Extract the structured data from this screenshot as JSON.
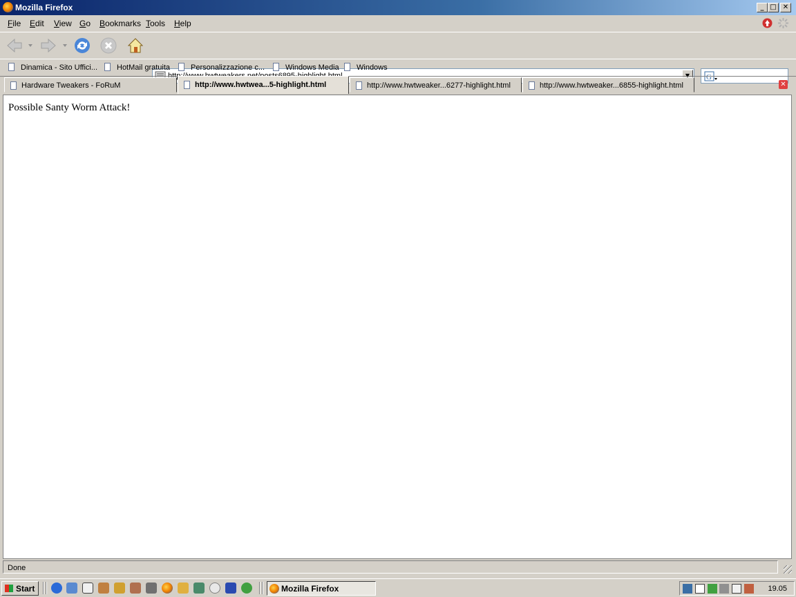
{
  "window": {
    "title": "Mozilla Firefox"
  },
  "menu": [
    {
      "accel": "F",
      "rest": "ile"
    },
    {
      "accel": "E",
      "rest": "dit"
    },
    {
      "accel": "V",
      "rest": "iew"
    },
    {
      "accel": "G",
      "rest": "o"
    },
    {
      "accel": "B",
      "rest": "ookmarks"
    },
    {
      "accel": "T",
      "rest": "ools"
    },
    {
      "accel": "H",
      "rest": "elp"
    }
  ],
  "nav": {
    "url": "http://www.hwtweakers.net/posts6895-highlight.html",
    "search_value": ""
  },
  "bookmarks": [
    "Dinamica - Sito Uffici...",
    "HotMail gratuita",
    "Personalizzazione c...",
    "Windows Media",
    "Windows"
  ],
  "tabs": [
    {
      "label": "Hardware Tweakers - FoRuM",
      "active": false
    },
    {
      "label": "http://www.hwtwea...5-highlight.html",
      "active": true
    },
    {
      "label": "http://www.hwtweaker...6277-highlight.html",
      "active": false
    },
    {
      "label": "http://www.hwtweaker...6855-highlight.html",
      "active": false
    }
  ],
  "content": {
    "text": "Possible Santy Worm Attack!"
  },
  "status": {
    "text": "Done"
  },
  "taskbar": {
    "start_label": "Start",
    "active_window": "Mozilla Firefox",
    "clock": "19.05"
  },
  "colors": {
    "titlebar_start": "#0a246a",
    "titlebar_end": "#a6caf0",
    "chrome": "#d4d0c8",
    "close_tab": "#e04040"
  }
}
